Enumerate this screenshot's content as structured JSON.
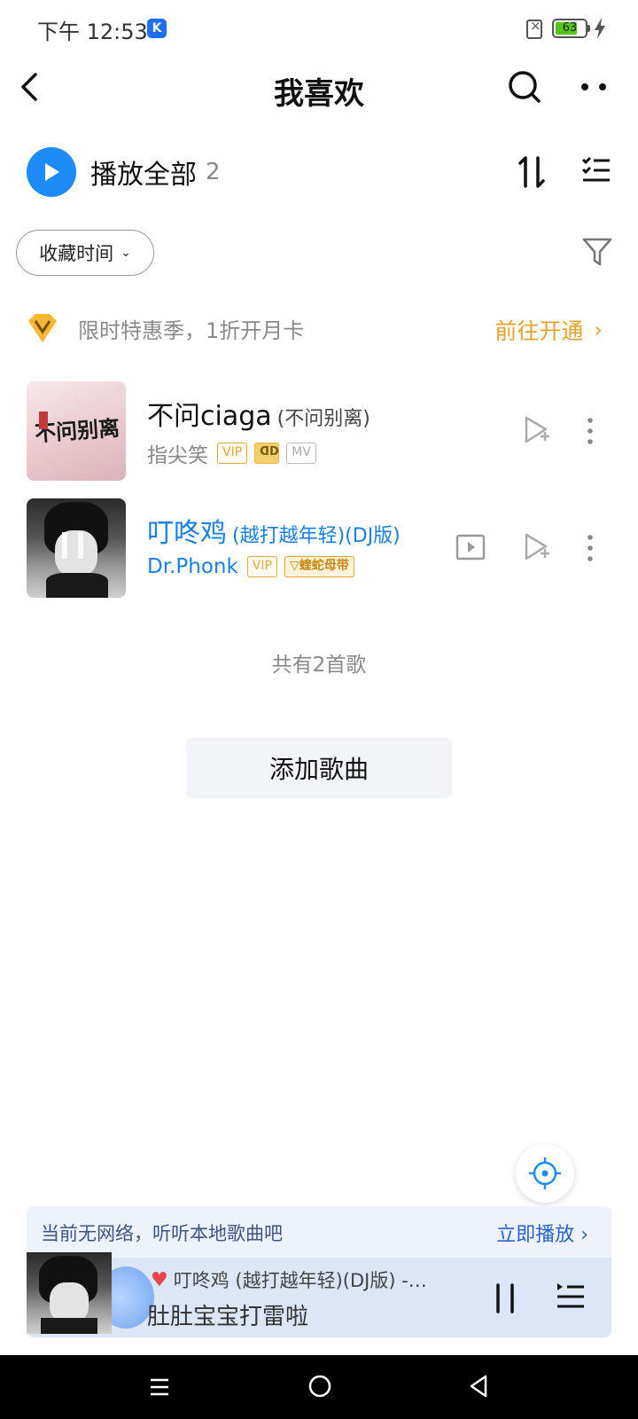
{
  "status_bar": {
    "time": "下午 12:53",
    "app_icon_letter": "K",
    "battery_level": "63"
  },
  "header": {
    "title": "我喜欢",
    "icons": [
      "back-icon",
      "search-icon",
      "more-icon"
    ]
  },
  "play_all": {
    "label": "播放全部",
    "count": "2"
  },
  "sort": {
    "label": "收藏时间"
  },
  "promo": {
    "text": "限时特惠季，1折开月卡",
    "link": "前往开通",
    "accent_color": "#e6a22b"
  },
  "songs": [
    {
      "title": "不问ciaga",
      "subtitle": "(不问别离)",
      "artist": "指尖笑",
      "badges": [
        "VIP",
        "MV"
      ],
      "cover_text": "不问别离",
      "playing": false
    },
    {
      "title": "叮咚鸡",
      "subtitle": "(越打越年轻)(DJ版)",
      "artist": "Dr.Phonk",
      "badges": [
        "VIP",
        "蝰蛇母带"
      ],
      "playing": true
    }
  ],
  "total_text": "共有2首歌",
  "add_button": "添加歌曲",
  "offline": {
    "text": "当前无网络，听听本地歌曲吧",
    "link": "立即播放"
  },
  "mini_player": {
    "title": "叮咚鸡 (越打越年轻)(DJ版) -…",
    "lyric": "肚肚宝宝打雷啦"
  },
  "colors": {
    "playing_blue": "#1a7fe4",
    "play_button": "#1d8cf8"
  }
}
